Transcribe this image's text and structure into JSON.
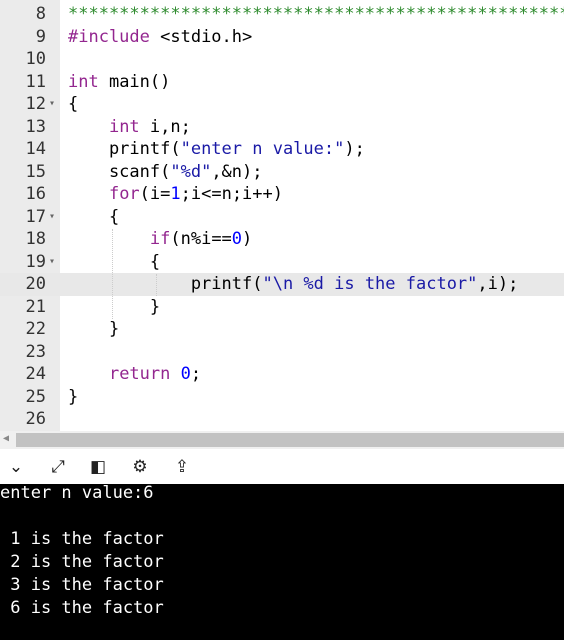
{
  "editor": {
    "lines": [
      {
        "n": "8",
        "fold": "",
        "active": false,
        "tokens": [
          {
            "t": "****************************************************",
            "c": "comment"
          }
        ]
      },
      {
        "n": "9",
        "fold": "",
        "active": false,
        "tokens": [
          {
            "t": "#include",
            "c": "kw"
          },
          {
            "t": " <stdio.h>",
            "c": ""
          }
        ]
      },
      {
        "n": "10",
        "fold": "",
        "active": false,
        "tokens": []
      },
      {
        "n": "11",
        "fold": "",
        "active": false,
        "tokens": [
          {
            "t": "int",
            "c": "kw"
          },
          {
            "t": " main()",
            "c": ""
          }
        ]
      },
      {
        "n": "12",
        "fold": "▾",
        "active": false,
        "tokens": [
          {
            "t": "{",
            "c": ""
          }
        ]
      },
      {
        "n": "13",
        "fold": "",
        "active": false,
        "tokens": [
          {
            "t": "    ",
            "c": ""
          },
          {
            "t": "int",
            "c": "kw"
          },
          {
            "t": " i,n;",
            "c": ""
          }
        ]
      },
      {
        "n": "14",
        "fold": "",
        "active": false,
        "tokens": [
          {
            "t": "    printf(",
            "c": ""
          },
          {
            "t": "\"enter n value:\"",
            "c": "str"
          },
          {
            "t": ");",
            "c": ""
          }
        ]
      },
      {
        "n": "15",
        "fold": "",
        "active": false,
        "tokens": [
          {
            "t": "    scanf(",
            "c": ""
          },
          {
            "t": "\"%d\"",
            "c": "str"
          },
          {
            "t": ",&n);",
            "c": ""
          }
        ]
      },
      {
        "n": "16",
        "fold": "",
        "active": false,
        "tokens": [
          {
            "t": "    ",
            "c": ""
          },
          {
            "t": "for",
            "c": "kw"
          },
          {
            "t": "(i=",
            "c": ""
          },
          {
            "t": "1",
            "c": "num"
          },
          {
            "t": ";i<=n;i++)",
            "c": ""
          }
        ]
      },
      {
        "n": "17",
        "fold": "▾",
        "active": false,
        "tokens": [
          {
            "t": "    {",
            "c": ""
          }
        ]
      },
      {
        "n": "18",
        "fold": "",
        "active": false,
        "tokens": [
          {
            "t": "        ",
            "c": ""
          },
          {
            "t": "if",
            "c": "kw"
          },
          {
            "t": "(n%i==",
            "c": ""
          },
          {
            "t": "0",
            "c": "num"
          },
          {
            "t": ")",
            "c": ""
          }
        ]
      },
      {
        "n": "19",
        "fold": "▾",
        "active": false,
        "tokens": [
          {
            "t": "        {",
            "c": ""
          }
        ]
      },
      {
        "n": "20",
        "fold": "",
        "active": true,
        "tokens": [
          {
            "t": "            printf(",
            "c": ""
          },
          {
            "t": "\"\\n %d is the factor\"",
            "c": "str"
          },
          {
            "t": ",i);",
            "c": ""
          }
        ]
      },
      {
        "n": "21",
        "fold": "",
        "active": false,
        "tokens": [
          {
            "t": "        }",
            "c": ""
          }
        ]
      },
      {
        "n": "22",
        "fold": "",
        "active": false,
        "tokens": [
          {
            "t": "    }",
            "c": ""
          }
        ]
      },
      {
        "n": "23",
        "fold": "",
        "active": false,
        "tokens": []
      },
      {
        "n": "24",
        "fold": "",
        "active": false,
        "tokens": [
          {
            "t": "    ",
            "c": ""
          },
          {
            "t": "return",
            "c": "kw"
          },
          {
            "t": " ",
            "c": ""
          },
          {
            "t": "0",
            "c": "num"
          },
          {
            "t": ";",
            "c": ""
          }
        ]
      },
      {
        "n": "25",
        "fold": "",
        "active": false,
        "tokens": [
          {
            "t": "}",
            "c": ""
          }
        ]
      },
      {
        "n": "26",
        "fold": "",
        "active": false,
        "tokens": []
      }
    ]
  },
  "toolbar": {
    "buttons": [
      {
        "name": "collapse-console-button",
        "icon": "chevron-down-icon",
        "glyph": "⌄"
      },
      {
        "name": "maximize-button",
        "icon": "expand-icon",
        "glyph": "⤢"
      },
      {
        "name": "layout-button",
        "icon": "layout-icon",
        "glyph": "◧"
      },
      {
        "name": "settings-button",
        "icon": "gear-icon",
        "glyph": "⚙"
      },
      {
        "name": "share-button",
        "icon": "share-icon",
        "glyph": "⇪"
      }
    ]
  },
  "console": {
    "lines": [
      "enter n value:6",
      "",
      " 1 is the factor",
      " 2 is the factor",
      " 3 is the factor",
      " 6 is the factor"
    ]
  },
  "colors": {
    "keyword": "#93268f",
    "string": "#1a1aa6",
    "number": "#0000ff",
    "comment": "#2e8b2e",
    "console_bg": "#000000",
    "console_text": "#ffffff"
  }
}
